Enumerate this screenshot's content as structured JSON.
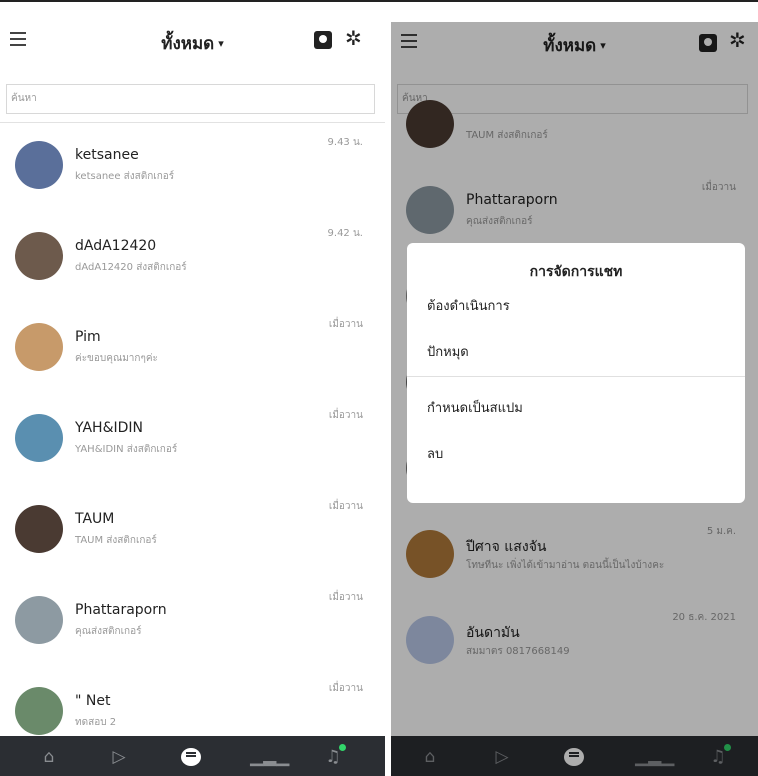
{
  "header": {
    "title": "ทั้งหมด",
    "caret": "▾"
  },
  "search": {
    "placeholder": "ค้นหา"
  },
  "left_chats": [
    {
      "name": "ketsanee",
      "message": "ketsanee ส่งสติกเกอร์",
      "time": "9.43 น.",
      "color": "#5a6f9a"
    },
    {
      "name": "dAdA12420",
      "message": "dAdA12420 ส่งสติกเกอร์",
      "time": "9.42 น.",
      "color": "#6d5a4c"
    },
    {
      "name": "Pim",
      "message": "ค่ะขอบคุณมากๆค่ะ",
      "time": "เมื่อวาน",
      "color": "#c79a6a"
    },
    {
      "name": "YAH&IDIN",
      "message": "YAH&IDIN ส่งสติกเกอร์",
      "time": "เมื่อวาน",
      "color": "#5a8fb0"
    },
    {
      "name": "TAUM",
      "message": "TAUM ส่งสติกเกอร์",
      "time": "เมื่อวาน",
      "color": "#4a3a32"
    },
    {
      "name": "Phattaraporn",
      "message": "คุณส่งสติกเกอร์",
      "time": "เมื่อวาน",
      "color": "#8d9aa2"
    },
    {
      "name": "\" Net",
      "message": "ทดสอบ 2",
      "time": "เมื่อวาน",
      "color": "#6a8a6a"
    }
  ],
  "right_chats": [
    {
      "name": "",
      "message": "TAUM ส่งสติกเกอร์",
      "time": "",
      "color": "#4a3a32"
    },
    {
      "name": "Phattaraporn",
      "message": "คุณส่งสติกเกอร์",
      "time": "เมื่อวาน",
      "color": "#8d9aa2"
    },
    {
      "name": "",
      "message": "",
      "time": "",
      "color": "#888"
    },
    {
      "name": "",
      "message": "",
      "time": "",
      "color": "#666"
    },
    {
      "name": "",
      "message": "",
      "time": "",
      "color": "#777"
    },
    {
      "name": "ปีศาจ แสงจัน",
      "message": "โทษทีนะ เพิ่งได้เข้ามาอ่าน ตอนนี้เป็นไงบ้างคะ",
      "time": "5 ม.ค.",
      "color": "#b07a3a"
    },
    {
      "name": "อันดามัน",
      "message": "สมมาตร 0817668149",
      "time": "20 ธ.ค. 2021",
      "color": "#b9c8e8"
    }
  ],
  "modal": {
    "title": "การจัดการแชท",
    "items": [
      "ต้องดำเนินการ",
      "ปักหมุด",
      "กำหนดเป็นสแปม",
      "ลบ"
    ]
  },
  "icons": {
    "menu": "hamburger-icon",
    "contacts": "contacts-icon",
    "settings": "gear-icon",
    "home": "home-icon",
    "play": "play-icon",
    "chat": "chat-icon",
    "stats": "chart-icon",
    "notify": "bell-icon"
  },
  "colors": {
    "tabbar": "#2b2e33",
    "badge": "#32d66a"
  }
}
